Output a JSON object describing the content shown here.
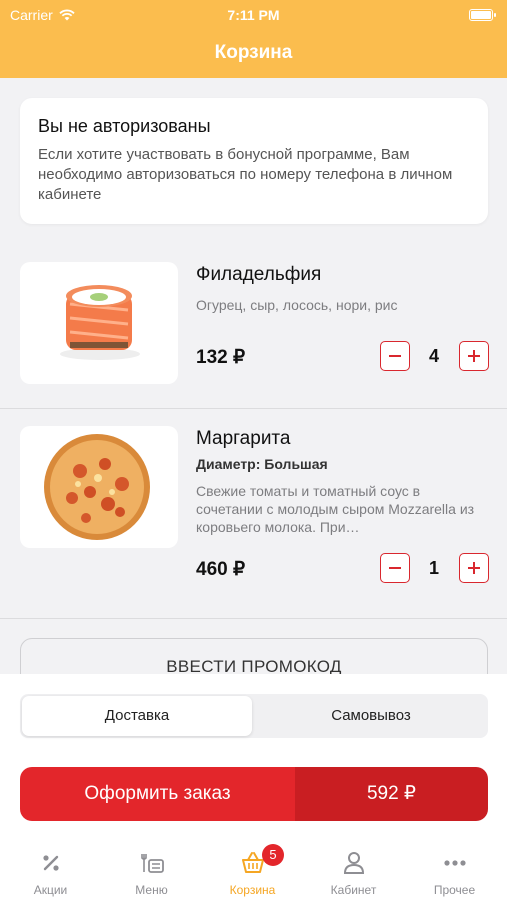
{
  "status_bar": {
    "carrier": "Carrier",
    "time": "7:11 PM"
  },
  "nav": {
    "title": "Корзина"
  },
  "auth_notice": {
    "title": "Вы не авторизованы",
    "text": "Если хотите участвовать в бонусной программе, Вам необходимо авторизоваться по номеру телефона в личном кабинете"
  },
  "cart_items": [
    {
      "name": "Филадельфия",
      "description": "Огурец, сыр, лосось, нори, рис",
      "price": "132 ₽",
      "quantity": "4",
      "icon": "sushi-roll-photo"
    },
    {
      "name": "Маргарита",
      "detail": "Диаметр: Большая",
      "description": "Свежие томаты и томатный соус в сочетании с молодым сыром Mozzarella из коровьего молока. При…",
      "price": "460 ₽",
      "quantity": "1",
      "icon": "pizza-photo"
    }
  ],
  "promo": {
    "label": "ВВЕСТИ ПРОМОКОД"
  },
  "delivery_toggle": {
    "options": [
      "Доставка",
      "Самовывоз"
    ],
    "selected": "Доставка"
  },
  "checkout": {
    "label": "Оформить заказ",
    "total": "592 ₽"
  },
  "tabbar": {
    "tabs": [
      {
        "label": "Акции",
        "icon": "percent-icon"
      },
      {
        "label": "Меню",
        "icon": "menu-food-icon"
      },
      {
        "label": "Корзина",
        "icon": "basket-icon",
        "badge": "5",
        "active": true
      },
      {
        "label": "Кабинет",
        "icon": "user-icon"
      },
      {
        "label": "Прочее",
        "icon": "more-dots-icon"
      }
    ]
  },
  "colors": {
    "header": "#fbbd4e",
    "accent_red": "#e3262b",
    "active_tab": "#f5a623"
  }
}
